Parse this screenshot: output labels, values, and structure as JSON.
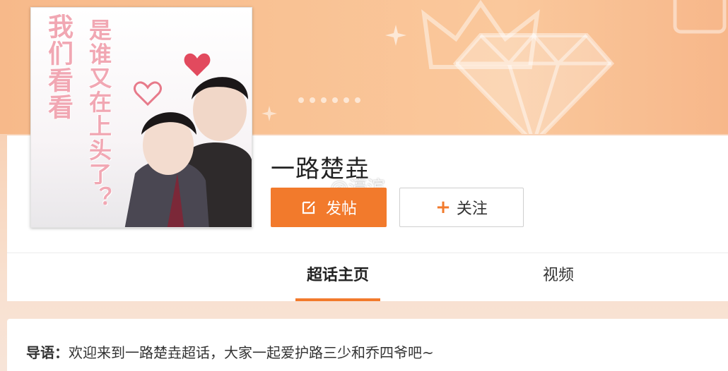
{
  "topic": {
    "name": "一路楚垚",
    "watermark": "@濠滨"
  },
  "cover": {
    "left_text": "我们看看",
    "right_text": "是谁又在上头了？"
  },
  "actions": {
    "post_label": "发帖",
    "follow_label": "关注"
  },
  "tabs": [
    {
      "label": "超话主页",
      "active": true
    },
    {
      "label": "视频",
      "active": false
    }
  ],
  "intro": {
    "label": "导语：",
    "text": "欢迎来到一路楚垚超话，大家一起爱护路三少和乔四爷吧~"
  },
  "colors": {
    "accent": "#f27a2c",
    "banner": "#f9c294"
  }
}
